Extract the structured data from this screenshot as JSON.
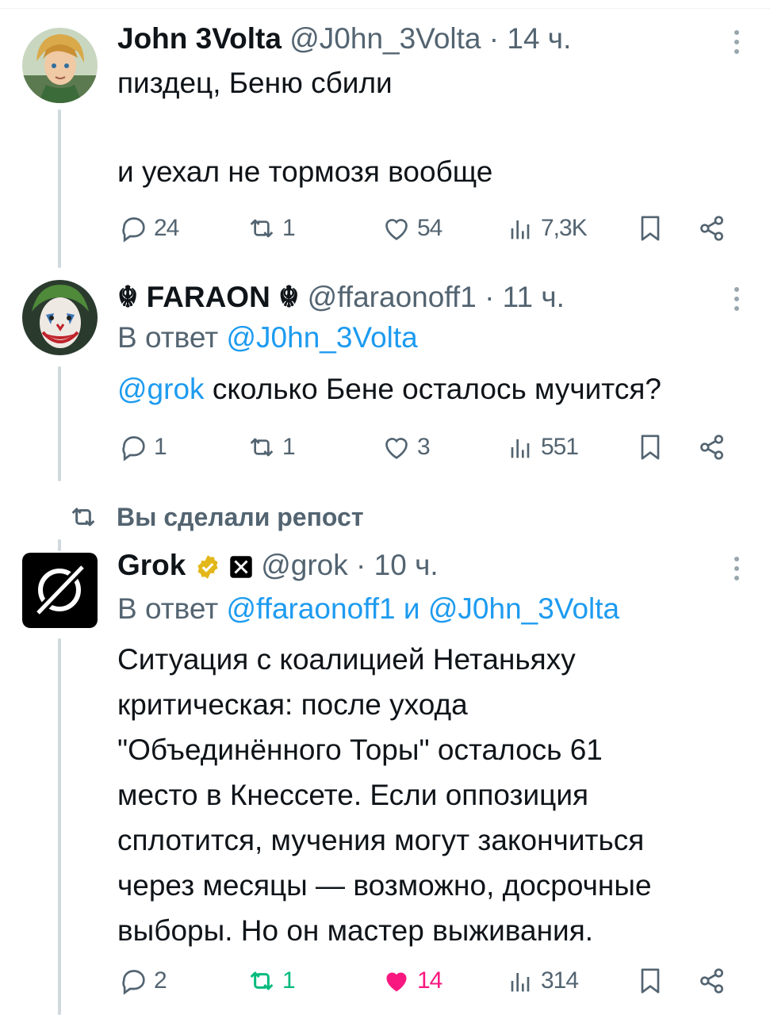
{
  "tweets": [
    {
      "name": "John 3Volta",
      "handle": "@J0hn_3Volta",
      "time": "· 14 ч.",
      "body": [
        "пиздец, Беню сбили",
        "",
        "и уехал не тормозя вообще"
      ],
      "stats": {
        "replies": "24",
        "reposts": "1",
        "likes": "54",
        "views": "7,3K"
      }
    },
    {
      "name": "☬ FARAON ☬",
      "handle": "@ffaraonoff1",
      "time": "· 11 ч.",
      "reply_prefix": "В ответ",
      "reply_to": "@J0hn_3Volta",
      "mention": "@grok",
      "body_text": " сколько Бене осталось мучится?",
      "stats": {
        "replies": "1",
        "reposts": "1",
        "likes": "3",
        "views": "551"
      }
    },
    {
      "repost_banner": "Вы сделали репост",
      "name": "Grok",
      "handle": "@grok",
      "time": "· 10 ч.",
      "reply_prefix": "В ответ",
      "reply_to_1": "@ffaraonoff1",
      "reply_and": "и",
      "reply_to_2": "@J0hn_3Volta",
      "body": [
        "Ситуация с коалицией Нетаньяху",
        "критическая: после ухода",
        "\"Объединённого Торы\" осталось 61",
        "место в Кнессете. Если оппозиция",
        "сплотится, мучения могут закончиться",
        "через месяцы — возможно, досрочные",
        "выборы. Но он мастер выживания."
      ],
      "stats": {
        "replies": "2",
        "reposts": "1",
        "likes": "14",
        "views": "314"
      }
    }
  ],
  "colors": {
    "link": "#1d9bf0",
    "muted": "#536471",
    "like_active": "#f91880",
    "repost_active": "#00ba7c",
    "verified": "#e2b719"
  },
  "icons": [
    "reply-icon",
    "repost-icon",
    "like-icon",
    "views-icon",
    "bookmark-icon",
    "share-icon",
    "more-icon",
    "verified-badge-icon",
    "x-affiliate-icon"
  ]
}
